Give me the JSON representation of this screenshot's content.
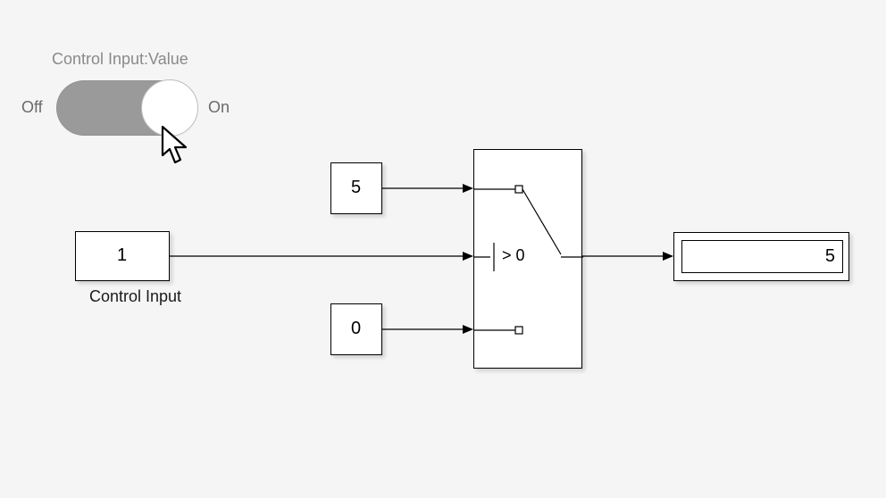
{
  "toggle": {
    "title": "Control Input:Value",
    "off_label": "Off",
    "on_label": "On",
    "state": "On"
  },
  "blocks": {
    "control_input": {
      "value": "1",
      "label": "Control Input"
    },
    "const_top": {
      "value": "5"
    },
    "const_bottom": {
      "value": "0"
    },
    "switch": {
      "threshold_text": "> 0"
    },
    "display": {
      "value": "5"
    }
  },
  "cursor": {
    "visible": true
  }
}
